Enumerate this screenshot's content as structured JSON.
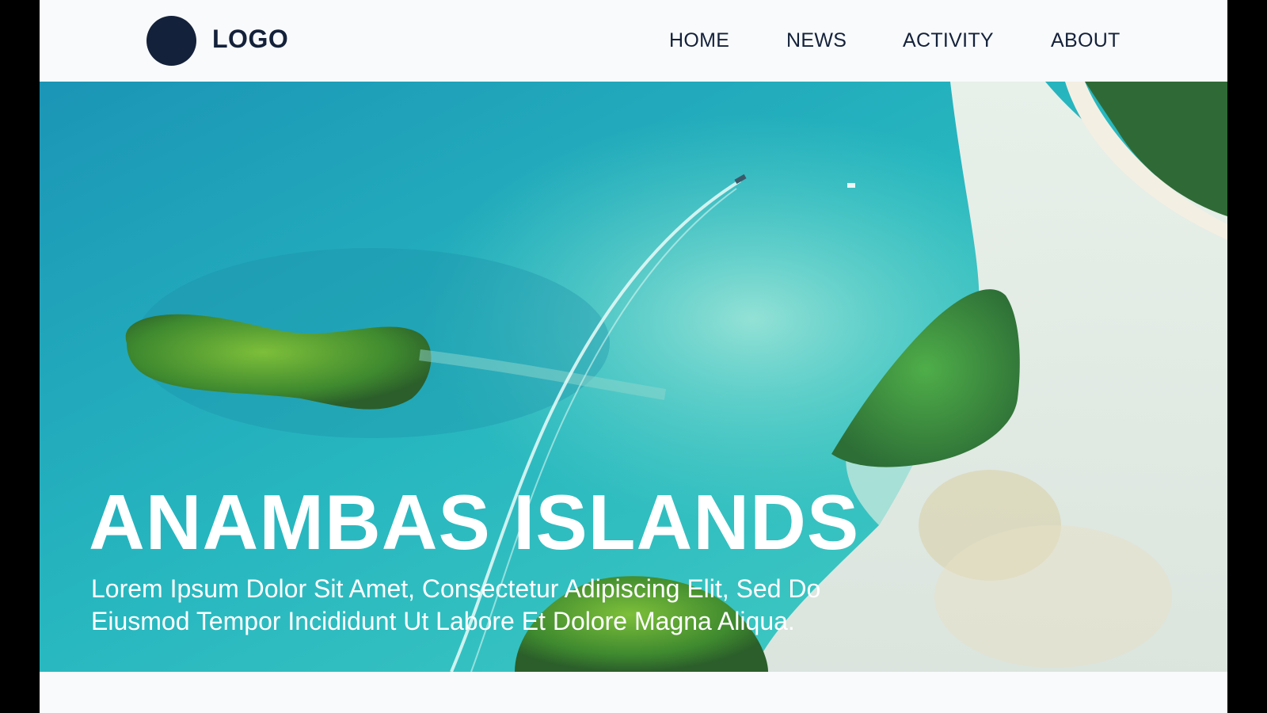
{
  "header": {
    "logo_text": "LOGO",
    "nav": {
      "home": "HOME",
      "news": "NEWS",
      "activity": "ACTIVITY",
      "about": "ABOUT"
    }
  },
  "hero": {
    "title": "ANAMBAS ISLANDS",
    "subtitle": "Lorem Ipsum Dolor Sit Amet, Consectetur Adipiscing Elit, Sed Do Eiusmod Tempor Incididunt Ut Labore Et Dolore Magna Aliqua.",
    "image_description_icon": "aerial-islands-image"
  },
  "colors": {
    "brand": "#14213a",
    "background": "#f8fafc",
    "water": "#27b3bc",
    "sand": "#e9eee8",
    "foliage": "#4f9a3a"
  }
}
